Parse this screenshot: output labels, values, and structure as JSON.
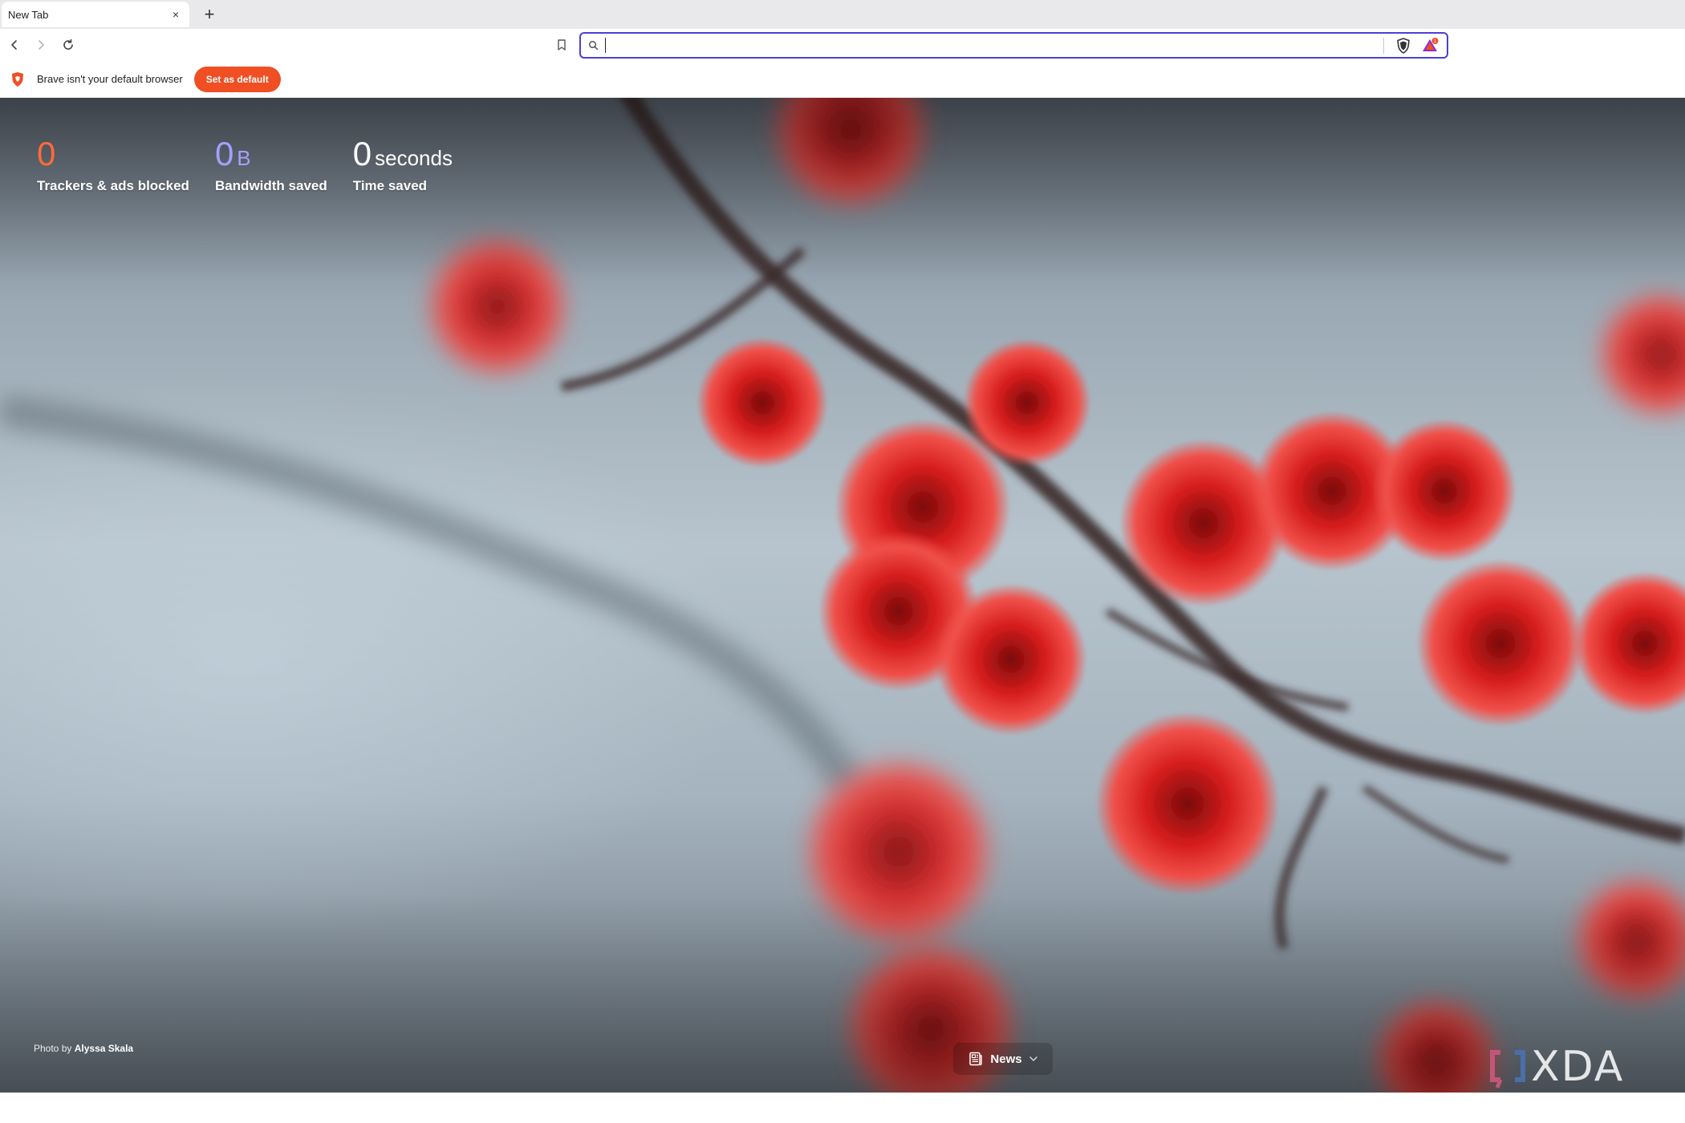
{
  "tab": {
    "title": "New Tab",
    "close_icon": "×",
    "new_tab_icon": "+"
  },
  "toolbar": {
    "omnibox_value": ""
  },
  "infobar": {
    "message": "Brave isn't your default browser",
    "set_default_label": "Set as default"
  },
  "stats": {
    "trackers": {
      "value": "0",
      "label": "Trackers & ads blocked"
    },
    "bandwidth": {
      "value": "0",
      "unit": "B",
      "label": "Bandwidth saved"
    },
    "time": {
      "value": "0",
      "unit": "seconds",
      "label": "Time saved"
    }
  },
  "photo_credit": {
    "prefix": "Photo by",
    "author": "Alyssa Skala"
  },
  "news": {
    "label": "News"
  },
  "watermark": {
    "text": "XDA"
  },
  "colors": {
    "brave_orange": "#f04e23",
    "omnibox_focus": "#4b3fd6",
    "tracker_count": "#ff6a3d",
    "bandwidth_count": "#a4a0ff"
  }
}
